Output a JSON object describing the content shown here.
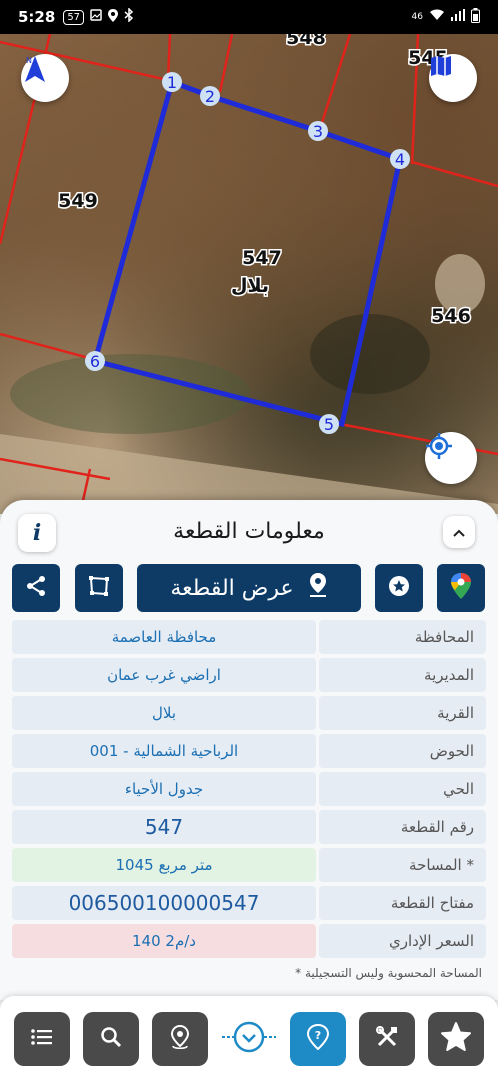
{
  "status_bar": {
    "time": "5:28",
    "badge": "57",
    "network": "46",
    "icons": [
      "notification-badge",
      "image-icon",
      "location-icon",
      "bluetooth-icon",
      "wifi-icon",
      "signal-icon",
      "battery-icon"
    ]
  },
  "map": {
    "parcel_labels": {
      "p549": "549",
      "p548": "548",
      "p545": "545",
      "p546": "546",
      "p547": "547",
      "p547_name": "بلال"
    },
    "vertex_labels": [
      "1",
      "2",
      "3",
      "4",
      "5",
      "6"
    ],
    "colors": {
      "parcel_outline": "#1f2bd8",
      "boundary": "#e0231b"
    },
    "buttons": [
      "compass-icon",
      "map-layers-icon",
      "my-location-icon"
    ]
  },
  "sheet": {
    "title": "معلومات القطعة",
    "info_label": "i",
    "show_parcel_label": "عرض القطعة",
    "rows": [
      {
        "label": "المحافظة",
        "value": "محافظة العاصمة"
      },
      {
        "label": "المديرية",
        "value": "اراضي غرب عمان"
      },
      {
        "label": "القرية",
        "value": "بلال"
      },
      {
        "label": "الحوض",
        "value": "الرباحية الشمالية - 001"
      },
      {
        "label": "الحي",
        "value": "جدول الأحياء"
      },
      {
        "label": "رقم القطعة",
        "value": "547"
      },
      {
        "label": "المساحة *",
        "value": "1045   متر مربع"
      },
      {
        "label": "مفتاح القطعة",
        "value": "006500100000547"
      },
      {
        "label": "السعر الإداري",
        "value": "140 د/م2"
      }
    ],
    "note": "* المساحة المحسوبة وليس التسجيلية",
    "colors": {
      "primary": "#0d3b66",
      "value_text": "#1b6fb3",
      "area_bg": "#e3f3e3",
      "price_bg": "#f6dde0"
    }
  },
  "bottom_nav": {
    "items": [
      "list-icon",
      "search-icon",
      "location-pin-icon",
      "chevron-down-icon",
      "help-icon",
      "tools-icon",
      "star-icon"
    ],
    "active": "help-icon"
  }
}
